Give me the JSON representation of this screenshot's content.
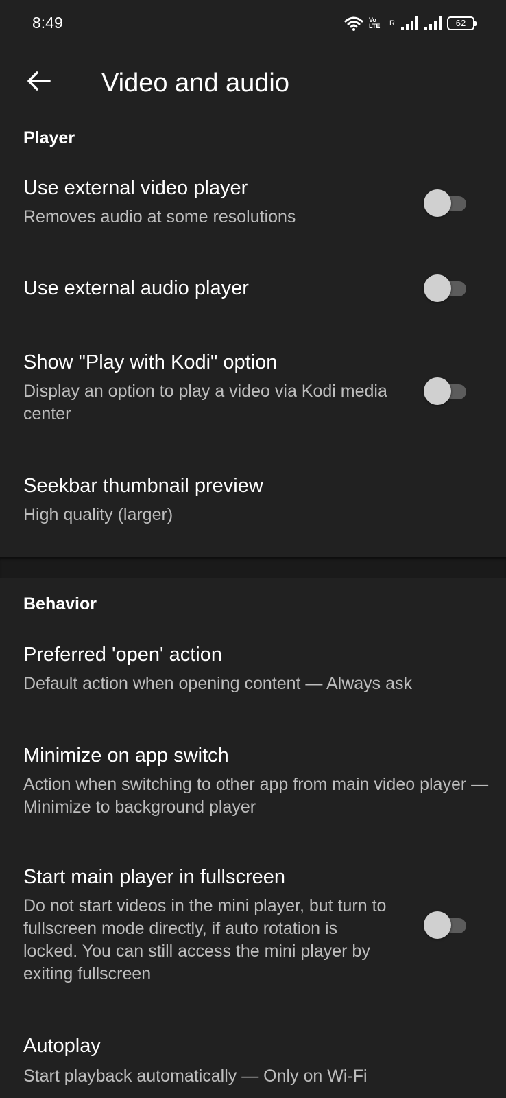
{
  "status_bar": {
    "time": "8:49",
    "volte_top": "Vo",
    "volte_bottom": "LTE",
    "roaming": "R",
    "battery": "62"
  },
  "app_bar": {
    "title": "Video and audio"
  },
  "sections": {
    "player": "Player",
    "behavior": "Behavior"
  },
  "prefs": {
    "ext_video": {
      "title": "Use external video player",
      "summary": "Removes audio at some resolutions",
      "enabled": false
    },
    "ext_audio": {
      "title": "Use external audio player",
      "enabled": false
    },
    "kodi": {
      "title": "Show \"Play with Kodi\" option",
      "summary": "Display an option to play a video via Kodi media center",
      "enabled": false
    },
    "seekbar": {
      "title": "Seekbar thumbnail preview",
      "summary": "High quality (larger)"
    },
    "open_action": {
      "title": "Preferred 'open' action",
      "summary": "Default action when opening content — Always ask"
    },
    "minimize": {
      "title": "Minimize on app switch",
      "summary": "Action when switching to other app from main video player — Minimize to background player"
    },
    "fullscreen": {
      "title": "Start main player in fullscreen",
      "summary": "Do not start videos in the mini player, but turn to fullscreen mode directly, if auto rotation is locked. You can still access the mini player by exiting fullscreen",
      "enabled": false
    },
    "autoplay": {
      "title": "Autoplay",
      "summary": "Start playback automatically — Only on Wi-Fi"
    }
  },
  "colors": {
    "background": "#212121",
    "summary_text": "#bdbdbd",
    "switch_thumb": "#d0d0d0",
    "switch_track": "#5c5c5c"
  }
}
